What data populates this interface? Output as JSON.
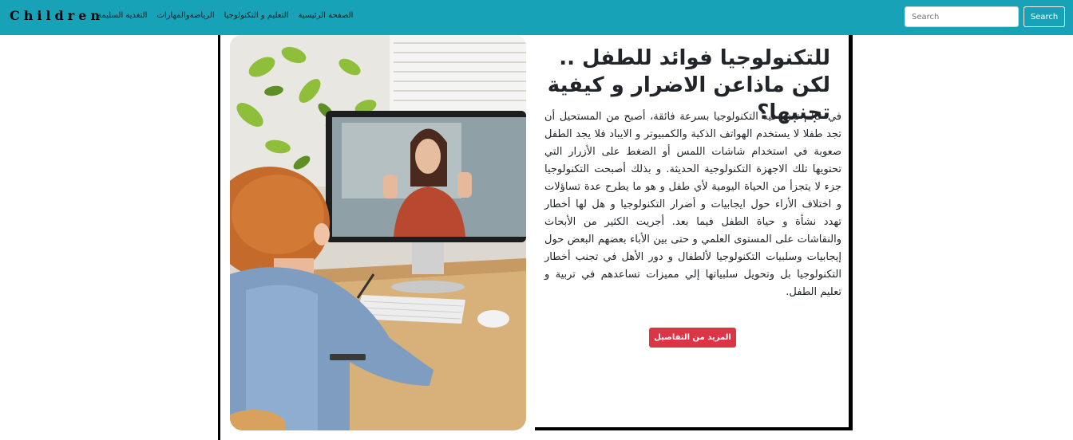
{
  "navbar": {
    "brand": "Children",
    "links": [
      "الصفحة الرئيسية",
      "التعليم و التكنولوجيا",
      "الرياضةوالمهارات",
      "التغذية السليمة"
    ],
    "search": {
      "placeholder": "Search",
      "button_label": "Search"
    },
    "background": "#17a2b8"
  },
  "article": {
    "title": "للتكنولوجيا فوائد للطفل .. لكن ماذاعن الاضرار و كيفية تجنبها؟",
    "body": "في عالم تغزو فيه التكنولوجيا بسرعة فائقة، أصبح من المستحيل أن تجد طفلا لا يستخدم الهواتف الذكية والكمبيوتر و الايباد فلا يجد الطفل صعوبة في استخدام شاشات اللمس أو الضغط على الأزرار التي تحتويها تلك الاجهزة التكنولوجية الحديثة. و بذلك أصبحت التكنولوجيا جزء لا يتجزأ من الحياة اليومية لأي طفل و هو ما يطرح عدة تساؤلات و اختلاف الأراء حول ايجابيات و أضرار التكنولوجيا و هل لها أخطار تهدد نشأة و حياة الطفل فيما بعد. أجريت الكثير من الأبحاث والنقاشات على المستوى العلمي و حتى بين الأباء بعضهم البعض حول إيجابيات وسلبيات التكنولوجيا لألطفال و دور الأهل في تجنب أخطار التكنولوجيا بل وتحويل سلبياتها إلي مميزات تساعدهم في تربية و تعليم الطفل.",
    "more_button": "المزيد من التفاصيل",
    "button_color": "#dc3545"
  },
  "image": {
    "subject": "child in video call with teacher on desktop computer"
  }
}
